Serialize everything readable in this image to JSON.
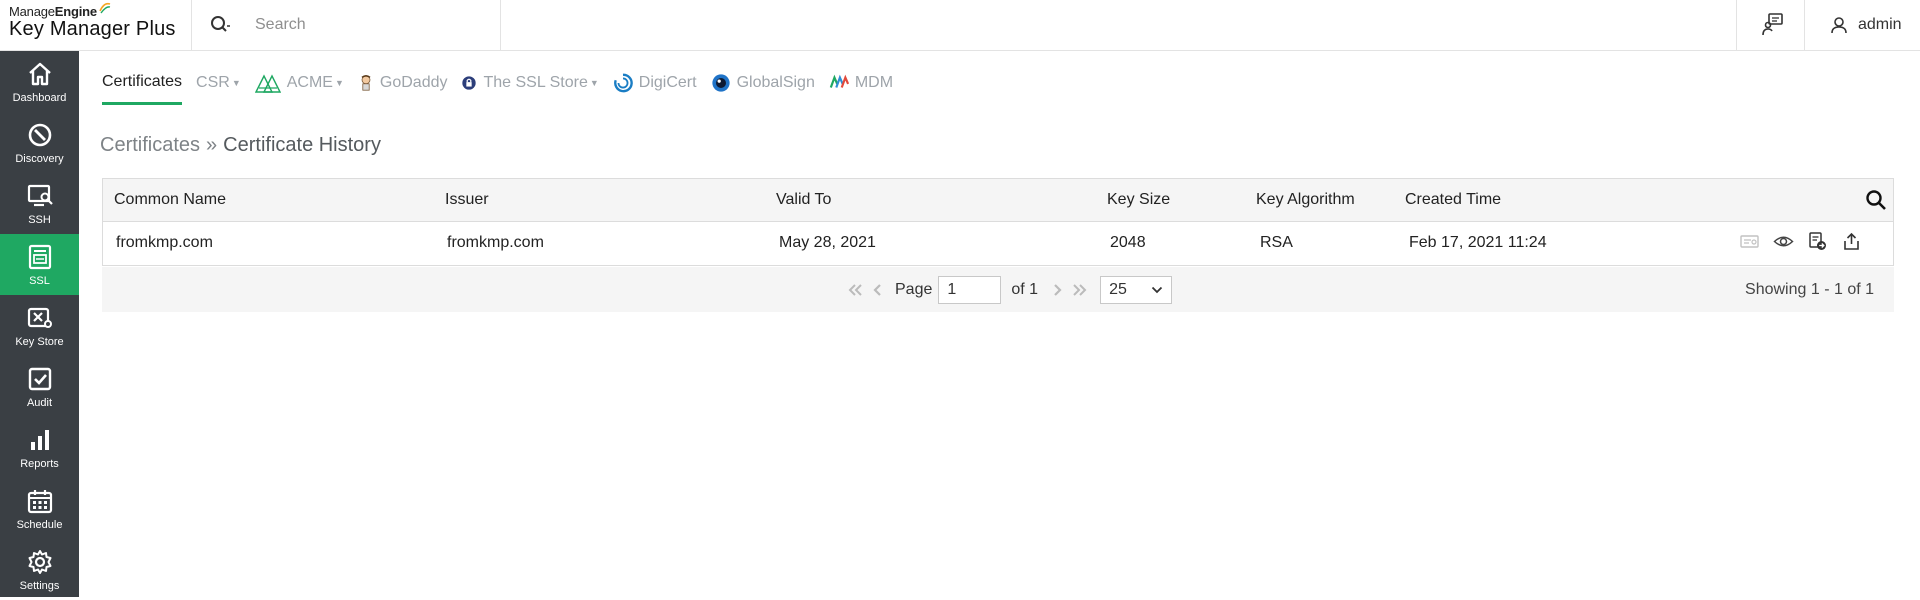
{
  "header": {
    "brand_top_regular": "Manage",
    "brand_top_bold": "Engine",
    "brand_main": "Key Manager Plus",
    "search_placeholder": "Search",
    "user_name": "admin",
    "icons": {
      "search": "search-dropdown-icon",
      "notification": "announcement-icon",
      "user": "user-icon"
    }
  },
  "sidebar": {
    "active_color": "#1fa862",
    "background": "#3a3f44",
    "items": [
      {
        "label": "Dashboard",
        "icon": "home-icon"
      },
      {
        "label": "Discovery",
        "icon": "discovery-icon"
      },
      {
        "label": "SSH",
        "icon": "ssh-icon"
      },
      {
        "label": "SSL",
        "icon": "ssl-icon",
        "active": true
      },
      {
        "label": "Key Store",
        "icon": "key-store-icon"
      },
      {
        "label": "Audit",
        "icon": "audit-icon"
      },
      {
        "label": "Reports",
        "icon": "reports-icon"
      },
      {
        "label": "Schedule",
        "icon": "schedule-icon"
      },
      {
        "label": "Settings",
        "icon": "settings-icon"
      }
    ]
  },
  "tabs": [
    {
      "label": "Certificates",
      "active": true
    },
    {
      "label": "CSR",
      "dropdown": true
    },
    {
      "label": "ACME",
      "dropdown": true,
      "icon": "acme-logo-icon"
    },
    {
      "label": "GoDaddy",
      "icon": "godaddy-logo-icon"
    },
    {
      "label": "The SSL Store",
      "dropdown": true,
      "icon": "ssl-store-logo-icon"
    },
    {
      "label": "DigiCert",
      "icon": "digicert-logo-icon"
    },
    {
      "label": "GlobalSign",
      "icon": "globalsign-logo-icon"
    },
    {
      "label": "MDM",
      "icon": "mdm-logo-icon"
    }
  ],
  "breadcrumb": {
    "parent": "Certificates",
    "separator": "»",
    "current": "Certificate History"
  },
  "table": {
    "columns": [
      "Common Name",
      "Issuer",
      "Valid To",
      "Key Size",
      "Key Algorithm",
      "Created Time"
    ],
    "rows": [
      {
        "common_name": "fromkmp.com",
        "issuer": "fromkmp.com",
        "valid_to": "May 28, 2021",
        "key_size": "2048",
        "key_algorithm": "RSA",
        "created_time": "Feb 17, 2021 11:24",
        "actions": [
          "certificate-details-icon",
          "view-icon",
          "deploy-icon",
          "export-icon"
        ]
      }
    ]
  },
  "pager": {
    "page_label": "Page",
    "page_value": "1",
    "of_label": "of 1",
    "page_size": "25",
    "showing": "Showing 1 - 1 of 1"
  }
}
